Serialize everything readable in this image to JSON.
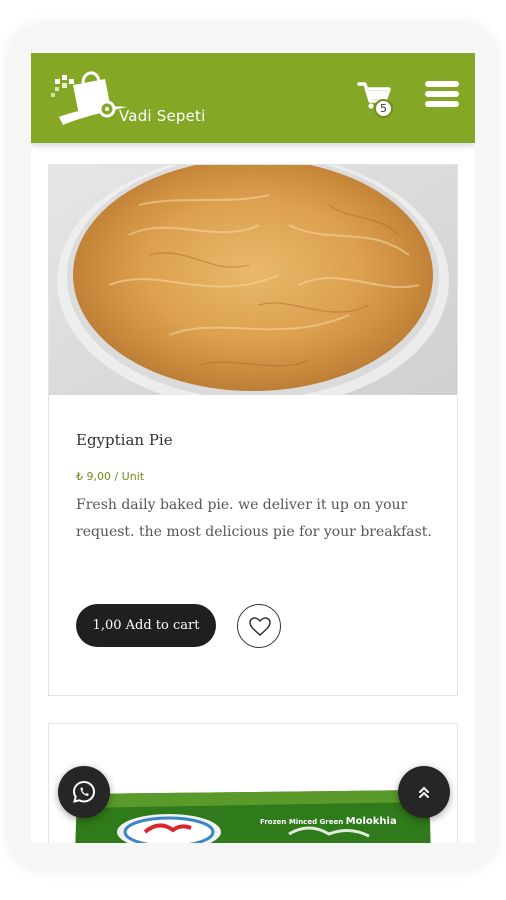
{
  "header": {
    "brand": "Vadi Sepeti",
    "cart_count": "5",
    "accent_color": "#84a726",
    "cart_icon": "shopping-cart-icon",
    "menu_icon": "hamburger-menu-icon"
  },
  "product": {
    "name": "Egyptian Pie",
    "price": "₺ 9,00 / Unit",
    "description": "Fresh daily baked pie. we deliver it up on your request. the most delicious pie for your breakfast.",
    "add_to_cart": "1,00 Add to cart",
    "wishlist_icon": "heart-icon"
  },
  "next_product": {
    "package_label_small": "Frozen Minced Green",
    "package_label_large": "Molokhia"
  },
  "floating": {
    "whatsapp_icon": "whatsapp-icon",
    "scroll_top_icon": "double-chevron-up-icon"
  }
}
